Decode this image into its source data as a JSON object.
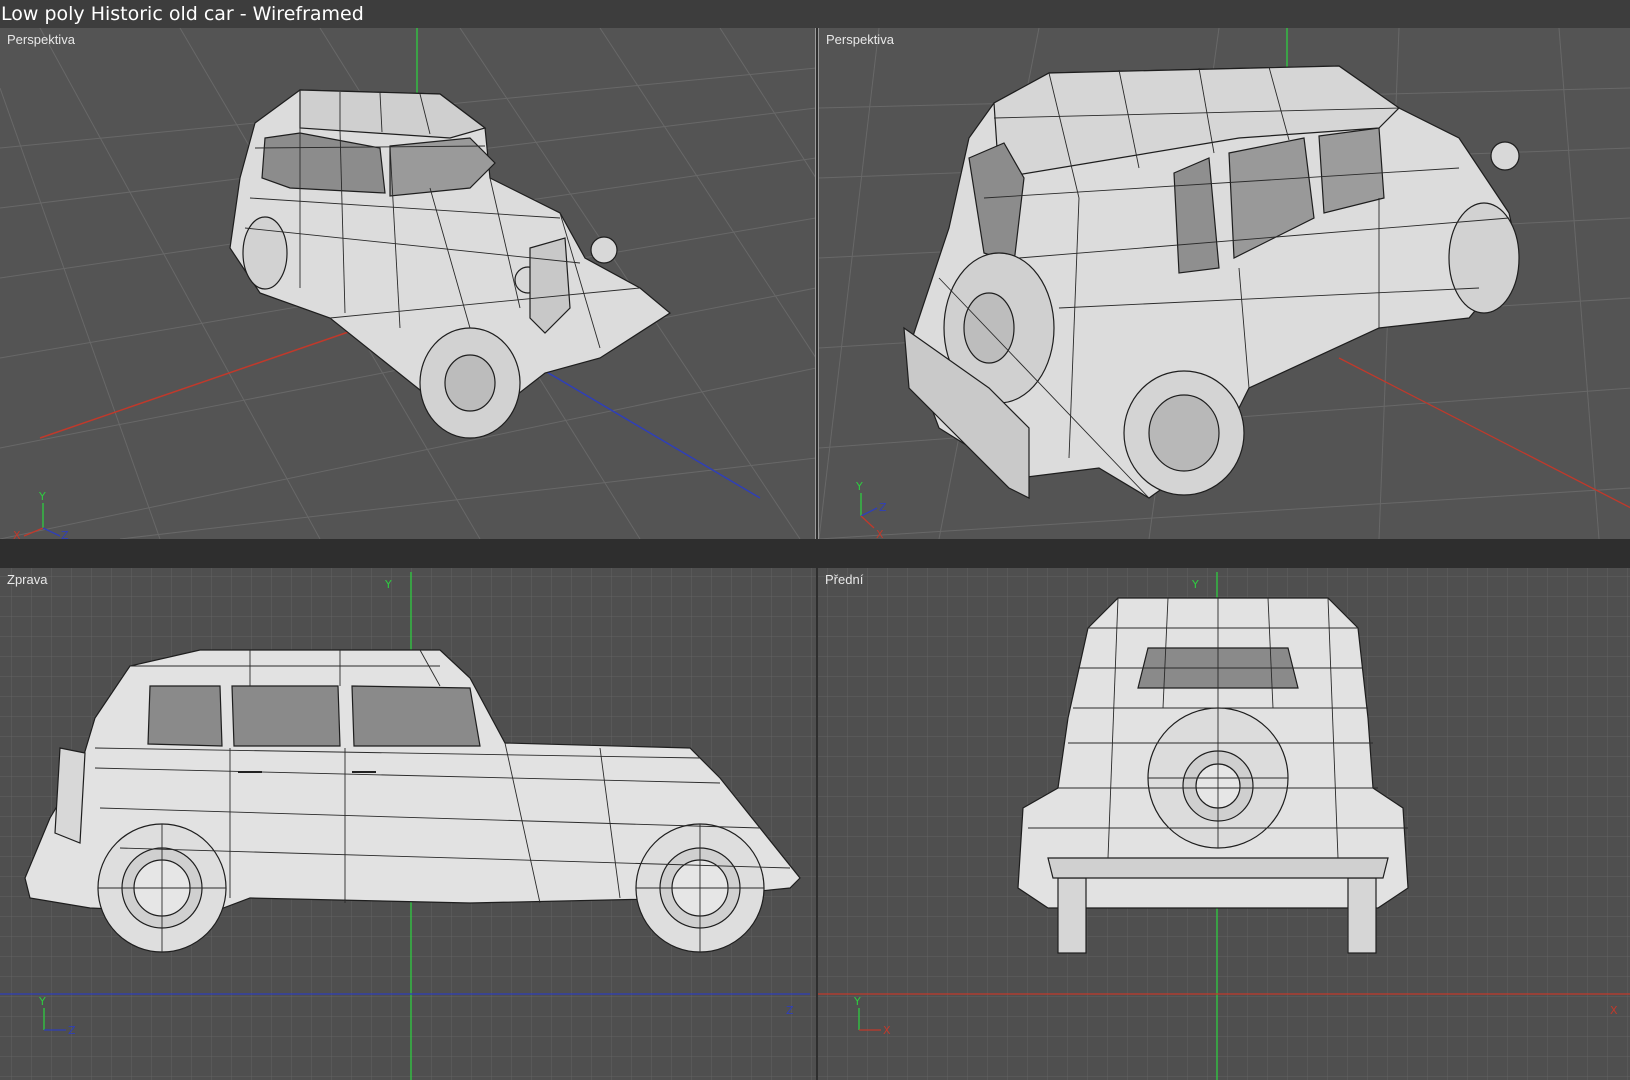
{
  "window": {
    "title": "Low poly Historic old car - Wireframed"
  },
  "viewports": [
    {
      "label": "Perspektiva",
      "view": "perspective"
    },
    {
      "label": "Perspektiva",
      "view": "perspective"
    },
    {
      "label": "Zprava",
      "view": "right"
    },
    {
      "label": "Přední",
      "view": "front"
    }
  ],
  "axis_labels": {
    "x": "X",
    "y": "Y",
    "z": "Z"
  },
  "colors": {
    "x_axis": "#c0392b",
    "y_axis": "#2ecc40",
    "z_axis": "#2f3fb8",
    "grid_major": "#6a6a6a",
    "grid_minor": "#5c5c5c",
    "model": "#e6e6e6"
  }
}
